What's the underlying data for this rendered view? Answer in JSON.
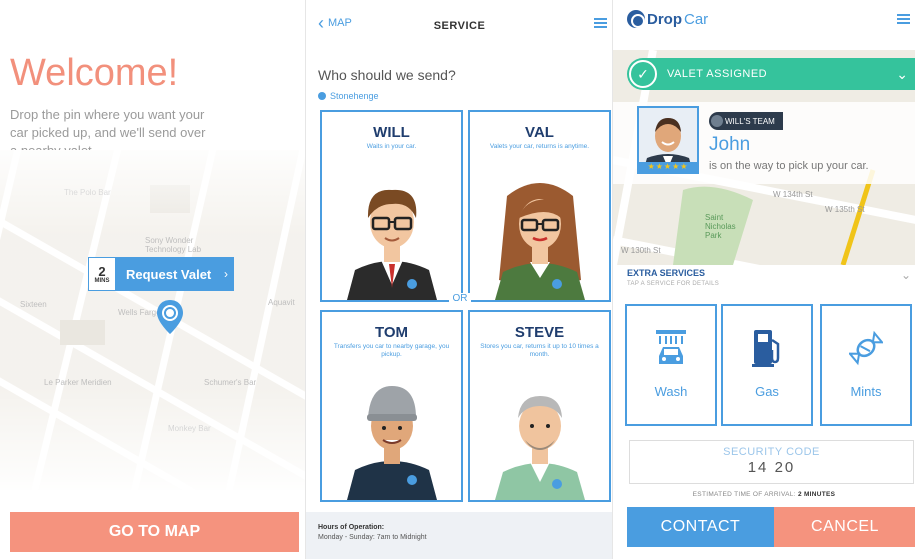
{
  "onboarding": {
    "title": "Welcome!",
    "body": "Drop the pin where you want your car picked up, and we'll send over a nearby valet.",
    "map_labels": [
      "The Polo Bar",
      "Sony Wonder Technology Lab",
      "Wells Fargo",
      "Sixteen",
      "Aquavit",
      "Le Parker Meridien",
      "Schumer's Bar",
      "Monkey Bar"
    ],
    "request_pill": {
      "minutes_value": "2",
      "minutes_unit": "MINS",
      "label": "Request Valet"
    },
    "go_to_map": "GO TO MAP"
  },
  "service": {
    "back_label": "MAP",
    "title": "SERVICE",
    "question": "Who should we send?",
    "location": "Stonehenge",
    "or_label": "OR",
    "valets": [
      {
        "name": "WILL",
        "desc": "Waits in your car."
      },
      {
        "name": "VAL",
        "desc": "Valets your car, returns is anytime."
      },
      {
        "name": "TOM",
        "desc": "Transfers you car to nearby garage, you pickup."
      },
      {
        "name": "STEVE",
        "desc": "Stores you car, returns it up to 10 times a month."
      }
    ],
    "hours_title": "Hours of Operation:",
    "hours_text": "Monday - Sunday: 7am to Midnight"
  },
  "status": {
    "logo_part1": "Drop",
    "logo_part2": "Car",
    "banner": "VALET ASSIGNED",
    "team": "WILL'S TEAM",
    "valet_name": "John",
    "valet_status": "is on the way to pick up your car.",
    "stars": "★★★★★",
    "map_labels": [
      "W 134th St",
      "W 135th St",
      "Saint Nicholas Park",
      "W 130th St"
    ],
    "extra_title": "EXTRA SERVICES",
    "extra_subtitle": "TAP A SERVICE FOR DETAILS",
    "services": [
      {
        "label": "Wash",
        "icon": "car-wash-icon"
      },
      {
        "label": "Gas",
        "icon": "gas-pump-icon"
      },
      {
        "label": "Mints",
        "icon": "mint-candy-icon"
      }
    ],
    "security_label": "SECURITY CODE",
    "security_code": "14 20",
    "eta_label": "ESTIMATED TIME OF ARRIVAL:",
    "eta_value": "2 MINUTES",
    "contact": "CONTACT",
    "cancel": "CANCEL"
  },
  "colors": {
    "primary": "#4a9de0",
    "accent": "#f5937e",
    "success": "#35c39c",
    "navy": "#1f3d6e"
  }
}
